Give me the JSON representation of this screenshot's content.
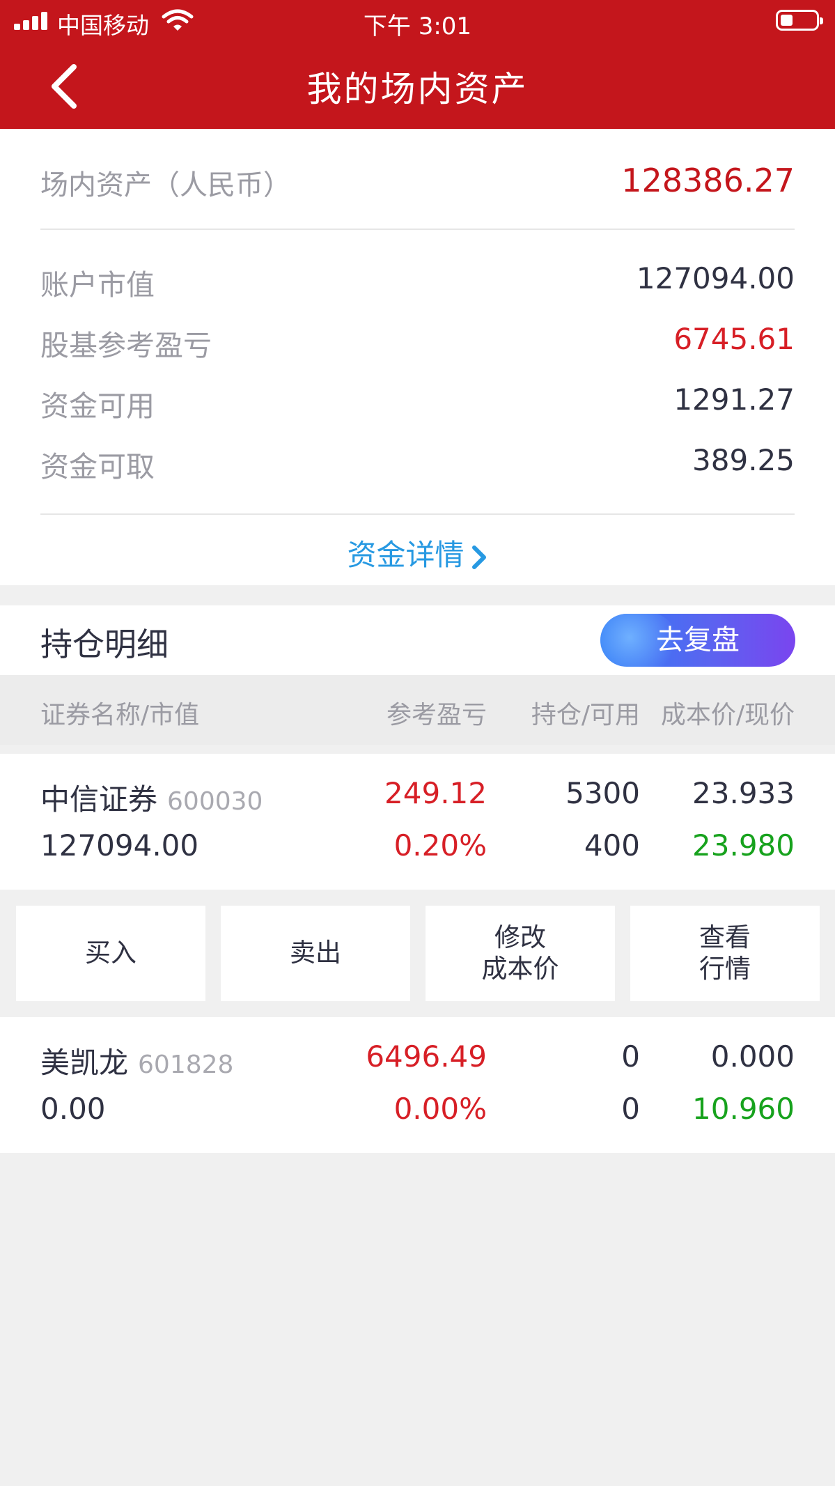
{
  "status_bar": {
    "carrier": "中国移动",
    "time": "下午 3:01"
  },
  "nav": {
    "title": "我的场内资产"
  },
  "assets": {
    "total_label": "场内资产（人民币）",
    "total_value": "128386.27",
    "rows": [
      {
        "label": "账户市值",
        "value": "127094.00"
      },
      {
        "label": "股基参考盈亏",
        "value": "6745.61"
      },
      {
        "label": "资金可用",
        "value": "1291.27"
      },
      {
        "label": "资金可取",
        "value": "389.25"
      }
    ],
    "detail_link": "资金详情"
  },
  "holdings": {
    "title": "持仓明细",
    "review_button": "去复盘",
    "columns": [
      "证券名称/市值",
      "参考盈亏",
      "持仓/可用",
      "成本价/现价"
    ],
    "stocks": [
      {
        "name": "中信证券",
        "code": "600030",
        "market_value": "127094.00",
        "pnl": "249.12",
        "pnl_pct": "0.20%",
        "position": "5300",
        "available": "400",
        "cost": "23.933",
        "price": "23.980"
      },
      {
        "name": "美凯龙",
        "code": "601828",
        "market_value": "0.00",
        "pnl": "6496.49",
        "pnl_pct": "0.00%",
        "position": "0",
        "available": "0",
        "cost": "0.000",
        "price": "10.960"
      }
    ],
    "actions": {
      "buy": "买入",
      "sell": "卖出",
      "edit_cost_line1": "修改",
      "edit_cost_line2": "成本价",
      "quote_line1": "查看",
      "quote_line2": "行情"
    }
  },
  "colors": {
    "brand_red": "#c4161c",
    "gain_red": "#d71f26",
    "price_green": "#17a21d",
    "link_blue": "#2799e2"
  }
}
